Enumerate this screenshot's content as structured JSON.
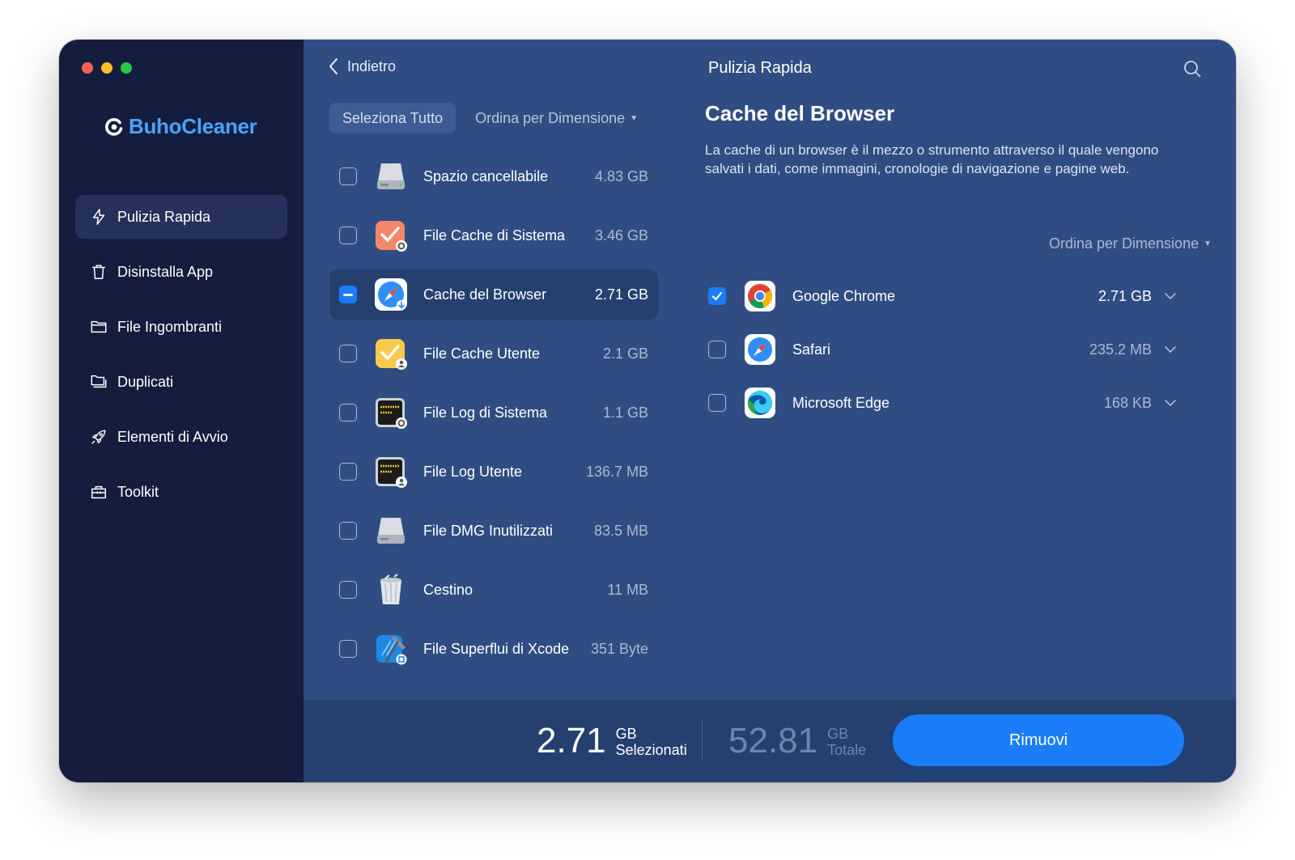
{
  "app": {
    "name": "BuhoCleaner"
  },
  "window": {
    "traffic_colors": [
      "#ff5f57",
      "#febc2e",
      "#28c840"
    ]
  },
  "sidebar": {
    "items": [
      {
        "label": "Pulizia Rapida",
        "icon": "lightning-icon",
        "active": true
      },
      {
        "label": "Disinstalla App",
        "icon": "trash-icon"
      },
      {
        "label": "File Ingombranti",
        "icon": "folder-icon"
      },
      {
        "label": "Duplicati",
        "icon": "duplicate-folder-icon"
      },
      {
        "label": "Elementi di Avvio",
        "icon": "rocket-icon"
      },
      {
        "label": "Toolkit",
        "icon": "toolbox-icon"
      }
    ]
  },
  "topbar": {
    "back_label": "Indietro",
    "title": "Pulizia Rapida"
  },
  "list": {
    "select_all_label": "Seleziona Tutto",
    "sort_label": "Ordina per Dimensione",
    "items": [
      {
        "label": "Spazio cancellabile",
        "size": "4.83 GB",
        "icon": "disk-icon",
        "state": "unchecked"
      },
      {
        "label": "File Cache di Sistema",
        "size": "3.46 GB",
        "icon": "system-cache-icon",
        "state": "unchecked"
      },
      {
        "label": "Cache del Browser",
        "size": "2.71 GB",
        "icon": "safari-compass-icon",
        "state": "mixed",
        "selected": true
      },
      {
        "label": "File Cache Utente",
        "size": "2.1 GB",
        "icon": "user-cache-icon",
        "state": "unchecked"
      },
      {
        "label": "File Log di Sistema",
        "size": "1.1 GB",
        "icon": "system-log-icon",
        "state": "unchecked"
      },
      {
        "label": "File Log Utente",
        "size": "136.7 MB",
        "icon": "user-log-icon",
        "state": "unchecked"
      },
      {
        "label": "File DMG Inutilizzati",
        "size": "83.5 MB",
        "icon": "dmg-disk-icon",
        "state": "unchecked"
      },
      {
        "label": "Cestino",
        "size": "11 MB",
        "icon": "trash-bin-icon",
        "state": "unchecked"
      },
      {
        "label": "File Superflui di Xcode",
        "size": "351 Byte",
        "icon": "xcode-icon",
        "state": "unchecked"
      }
    ]
  },
  "detail": {
    "title": "Cache del Browser",
    "description": "La cache di un browser è il mezzo o strumento attraverso il quale vengono salvati i dati, come immagini, cronologie di navigazione e pagine web.",
    "sort_label": "Ordina per Dimensione",
    "browsers": [
      {
        "label": "Google Chrome",
        "size": "2.71 GB",
        "icon": "chrome-icon",
        "checked": true
      },
      {
        "label": "Safari",
        "size": "235.2 MB",
        "icon": "safari-icon",
        "checked": false
      },
      {
        "label": "Microsoft Edge",
        "size": "168 KB",
        "icon": "edge-icon",
        "checked": false
      }
    ]
  },
  "footer": {
    "selected_value": "2.71",
    "selected_unit": "GB",
    "selected_label": "Selezionati",
    "total_value": "52.81",
    "total_unit": "GB",
    "total_label": "Totale",
    "remove_label": "Rimuovi"
  },
  "colors": {
    "sidebar_bg": "#141d3e",
    "main_bg": "#2f4d82",
    "accent": "#1a7cf7",
    "logo": "#4aa3ff"
  }
}
